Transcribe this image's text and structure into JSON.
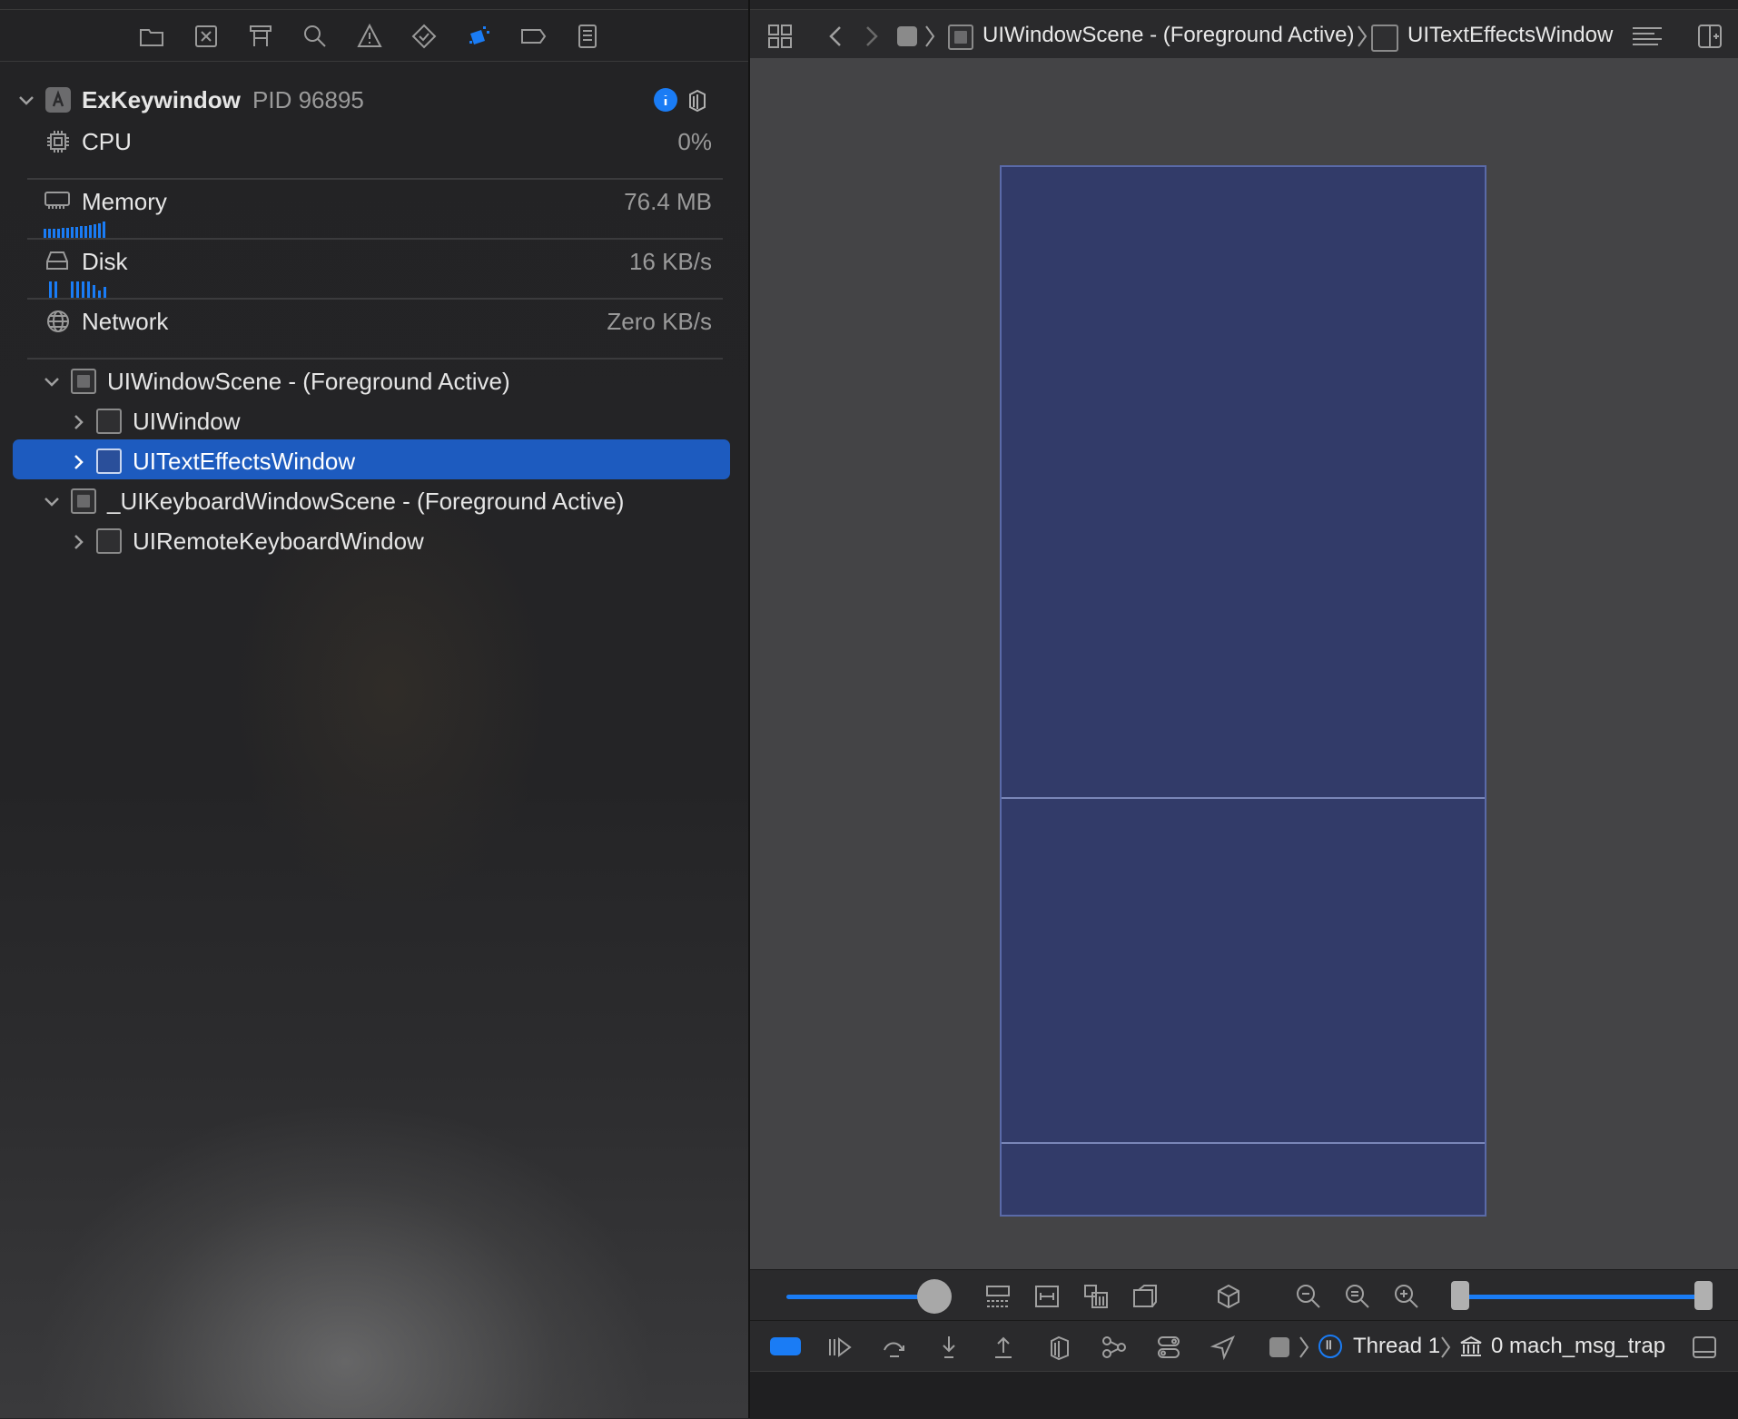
{
  "process": {
    "name": "ExKeywindow",
    "pid_label": "PID 96895"
  },
  "gauges": [
    {
      "label": "CPU",
      "value": "0%",
      "icon": "cpu-icon"
    },
    {
      "label": "Memory",
      "value": "76.4 MB",
      "icon": "memory-icon"
    },
    {
      "label": "Disk",
      "value": "16 KB/s",
      "icon": "disk-icon"
    },
    {
      "label": "Network",
      "value": "Zero KB/s",
      "icon": "network-icon"
    }
  ],
  "tree": [
    {
      "label": "UIWindowScene - (Foreground Active)",
      "expanded": true,
      "selected": false
    },
    {
      "label": "UIWindow",
      "expanded": false,
      "selected": false
    },
    {
      "label": "UITextEffectsWindow",
      "expanded": false,
      "selected": true
    },
    {
      "label": "_UIKeyboardWindowScene - (Foreground Active)",
      "expanded": true,
      "selected": false
    },
    {
      "label": "UIRemoteKeyboardWindow",
      "expanded": false,
      "selected": false
    }
  ],
  "breadcrumb": {
    "scene": "UIWindowScene - (Foreground Active)",
    "window": "UITextEffectsWindow"
  },
  "debug_bar": {
    "thread": "Thread 1",
    "frame": "0 mach_msg_trap"
  },
  "colors": {
    "selection": "#1d5bbf",
    "accent": "#1a7cf5",
    "view_fill": "#323b69"
  },
  "navigator_icons": [
    "folder-icon",
    "source-control-icon",
    "hierarchy-icon",
    "find-icon",
    "issue-icon",
    "test-icon",
    "debug-icon",
    "breakpoint-icon",
    "report-icon"
  ]
}
